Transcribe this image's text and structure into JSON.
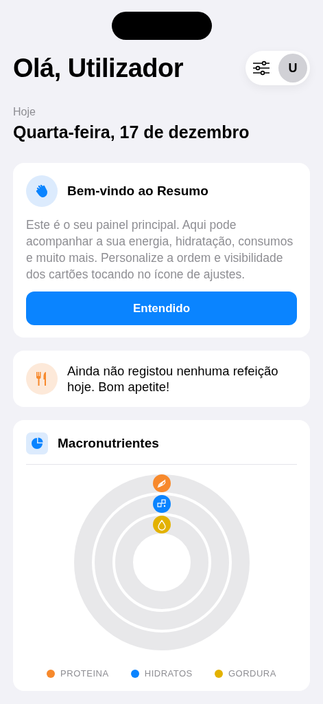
{
  "header": {
    "title": "Olá, Utilizador",
    "avatar": "U"
  },
  "date": {
    "label": "Hoje",
    "value": "Quarta-feira, 17 de dezembro"
  },
  "welcome_card": {
    "title": "Bem-vindo ao Resumo",
    "body": "Este é o seu painel principal. Aqui pode acompanhar a sua energia, hidratação, consumos e muito mais. Personalize a ordem e visibilidade dos cartões tocando no ícone de ajustes.",
    "button": "Entendido"
  },
  "meal_card": {
    "text": "Ainda não registou nenhuma refeição hoje. Bom apetite!"
  },
  "macros_card": {
    "title": "Macronutrientes",
    "rings": [
      {
        "kind": "protein",
        "label": "PROTEINA",
        "color": "#f7892c"
      },
      {
        "kind": "carbs",
        "label": "HIDRATOS",
        "color": "#0a84ff"
      },
      {
        "kind": "fat",
        "label": "GORDURA",
        "color": "#e3b200"
      }
    ]
  }
}
